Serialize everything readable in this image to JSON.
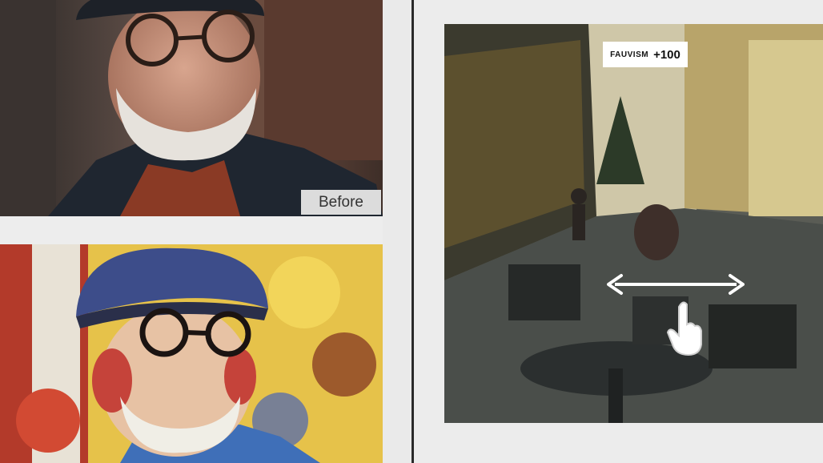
{
  "before_photo": {
    "label": "Before"
  },
  "filter": {
    "name": "FAUVISM",
    "value": "+100"
  },
  "icons": {
    "swipe": "double-arrow-icon",
    "hand": "pointing-hand-icon"
  },
  "colors": {
    "badge_bg": "#ffffff",
    "label_bg": "#dcdcdc",
    "divider": "#2a2a2a"
  }
}
